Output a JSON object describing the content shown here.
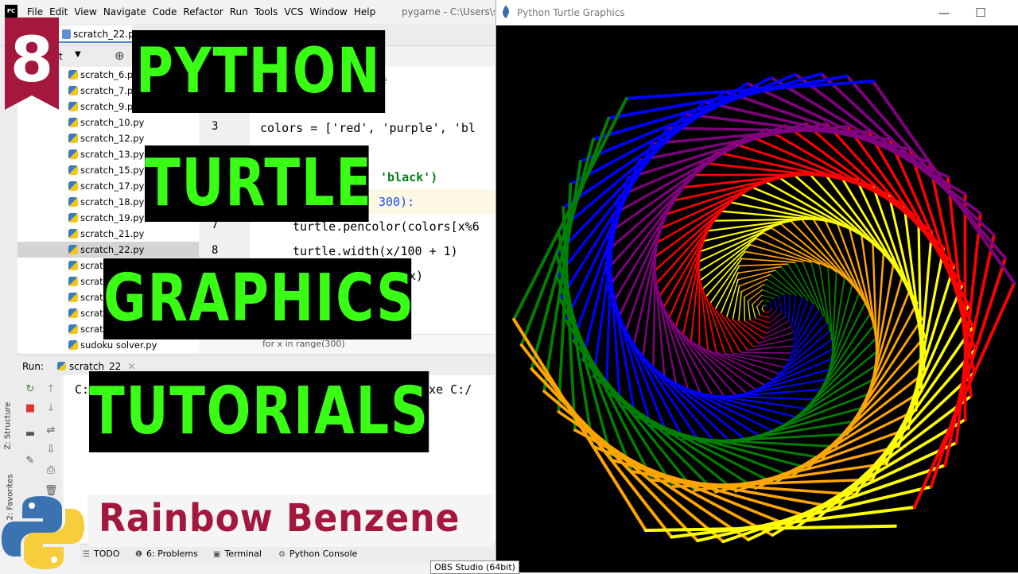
{
  "ide": {
    "app_badge": "PC",
    "menu": [
      "File",
      "Edit",
      "View",
      "Navigate",
      "Code",
      "Refactor",
      "Run",
      "Tools",
      "VCS",
      "Window",
      "Help"
    ],
    "window_title": "pygame - C:\\Users\\su",
    "editor_tab": "scratch_22.py",
    "project_label": "ect",
    "project_files": [
      "scratch_6.py",
      "scratch_7.py",
      "scratch_9.py",
      "scratch_10.py",
      "scratch_12.py",
      "scratch_13.py",
      "scratch_15.py",
      "scratch_17.py",
      "scratch_18.py",
      "scratch_19.py",
      "scratch_21.py",
      "scratch_22.py",
      "scrato",
      "scrato",
      "scrato",
      "scrato",
      "scrato",
      "sudoku solver.py"
    ],
    "selected_file": "scratch_22.py",
    "code_lines": [
      {
        "num": "",
        "text": "e"
      },
      {
        "num": "3",
        "text": "colors = ['red', 'purple', 'bl"
      },
      {
        "num": "",
        "text": "'black')"
      },
      {
        "num": "",
        "text": "300):"
      },
      {
        "num": "7",
        "text": "turtle.pencolor(colors[x%6"
      },
      {
        "num": "8",
        "text": "turtle.width(x/100 + 1)"
      },
      {
        "num": "",
        "text": "x)"
      }
    ],
    "breadcrumb": "for x in range(300)",
    "run_label": "Run:",
    "run_tab": "scratch_22",
    "console_line_start": "C:",
    "console_line_end": "n.exe C:/",
    "side_labels": {
      "structure": "Z: Structure",
      "favorites": "2: Favorites"
    },
    "status_items": [
      {
        "icon": "☰",
        "label": "TODO"
      },
      {
        "icon": "❶",
        "label": "6: Problems"
      },
      {
        "icon": "▣",
        "label": "Terminal"
      },
      {
        "icon": "⚙",
        "label": "Python Console"
      }
    ]
  },
  "turtle_window": {
    "title": "Python Turtle Graphics",
    "controls": [
      "—",
      "☐",
      "✕"
    ],
    "pen_colors": [
      "red",
      "purple",
      "blue",
      "green",
      "orange",
      "yellow"
    ]
  },
  "taskbar": {
    "obs_label": "OBS Studio (64bit)"
  },
  "overlay": {
    "episode_number": "8",
    "title_lines": [
      "PYTHON",
      "TURTLE",
      "GRAPHICS",
      "TUTORIALS"
    ],
    "subtitle": "Rainbow Benzene",
    "colors": {
      "title_text": "#39ff14",
      "title_bg": "#000000",
      "subtitle": "#a3183c",
      "badge": "#a3183c"
    }
  }
}
